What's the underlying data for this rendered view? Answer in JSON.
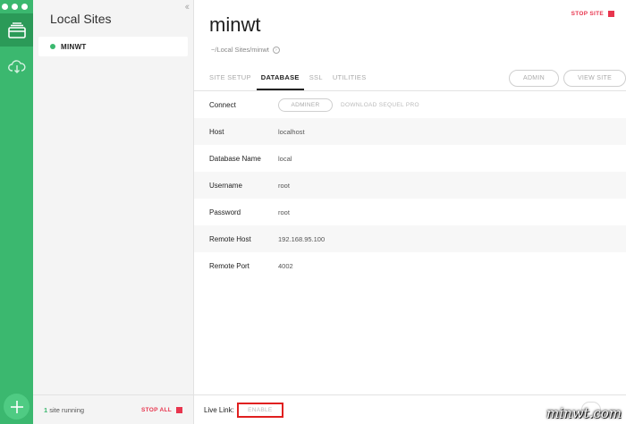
{
  "sidebar": {
    "title": "Local Sites",
    "sites": [
      {
        "name": "MINWT",
        "status_color": "#3bb86f"
      }
    ],
    "footer": {
      "running_count": "1",
      "running_text": "site running",
      "stop_all": "STOP ALL"
    }
  },
  "site": {
    "title": "minwt",
    "path": "~/Local Sites/minwt",
    "stop_site": "STOP SITE"
  },
  "tabs": [
    {
      "label": "SITE SETUP",
      "active": false
    },
    {
      "label": "DATABASE",
      "active": true
    },
    {
      "label": "SSL",
      "active": false
    },
    {
      "label": "UTILITIES",
      "active": false
    }
  ],
  "header_buttons": {
    "admin": "ADMIN",
    "view_site": "VIEW SITE"
  },
  "database": {
    "connect": {
      "label": "Connect",
      "adminer": "ADMINER",
      "sequel": "DOWNLOAD SEQUEL PRO"
    },
    "rows": [
      {
        "label": "Host",
        "value": "localhost"
      },
      {
        "label": "Database Name",
        "value": "local"
      },
      {
        "label": "Username",
        "value": "root"
      },
      {
        "label": "Password",
        "value": "root"
      },
      {
        "label": "Remote Host",
        "value": "192.168.95.100"
      },
      {
        "label": "Remote Port",
        "value": "4002"
      }
    ]
  },
  "footer": {
    "live_link_label": "Live Link:",
    "enable": "ENABLE"
  },
  "watermark": "minwt.com",
  "colors": {
    "accent_green": "#3bb86f",
    "stop_red": "#e8354e",
    "highlight_box": "#e02020"
  }
}
